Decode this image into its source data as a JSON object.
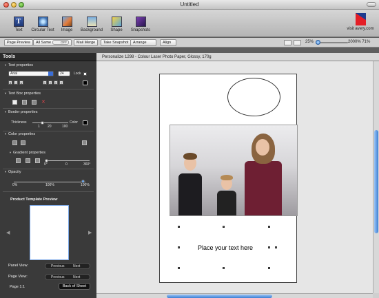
{
  "window": {
    "title": "Untitled"
  },
  "toolbar": {
    "buttons": [
      {
        "label": "Text",
        "icon": "text-icon"
      },
      {
        "label": "Circular Text",
        "icon": "circular-text-icon"
      },
      {
        "label": "Image",
        "icon": "image-icon"
      },
      {
        "label": "Background",
        "icon": "background-icon"
      },
      {
        "label": "Shape",
        "icon": "shape-icon"
      },
      {
        "label": "Snapshots",
        "icon": "snapshots-icon"
      }
    ],
    "brand_link": "visit avery.com"
  },
  "actionbar": {
    "page_preview": "Page Preview",
    "all_same": "All Same",
    "all_same_state": "OFF",
    "mail_merge": "Mail Merge",
    "take_snapshot": "Take Snapshot",
    "arrange": "Arrange",
    "align": "Align",
    "zoom_min": "25%",
    "zoom_max": "2000% 71%"
  },
  "tools": {
    "title": "Tools",
    "text_properties": "Text properties",
    "font": "Arial",
    "size": "24",
    "lock": "Lock",
    "textbox_properties": "Text Box properties",
    "border_properties": "Border properties",
    "thickness": "Thickness",
    "thickness_ticks": [
      "1",
      "20",
      "100"
    ],
    "color": "Color",
    "color_properties": "Color properties",
    "gradient_properties": "Gradient properties",
    "gradient_ticks": [
      "0°",
      "0",
      "360°"
    ],
    "opacity": "Opacity",
    "opacity_ticks": [
      "0%",
      "100%",
      "100%"
    ],
    "preview_title": "Product Template Preview",
    "panel_view": "Panel View:",
    "page_view": "Page View:",
    "previous": "Previous",
    "next": "Next",
    "page_info": "Page 1:1",
    "back_of_sheet": "Back of Sheet"
  },
  "canvas": {
    "header": "Personalize 1298 - Colour Laser Photo Paper, Glossy, 170g",
    "placeholder_text": "Place your text here"
  },
  "colors": {
    "panel_bg": "#3a3a3a",
    "canvas_bg": "#e6e6e6",
    "accent": "#3d7fd4",
    "brand_red": "#e41e26"
  }
}
